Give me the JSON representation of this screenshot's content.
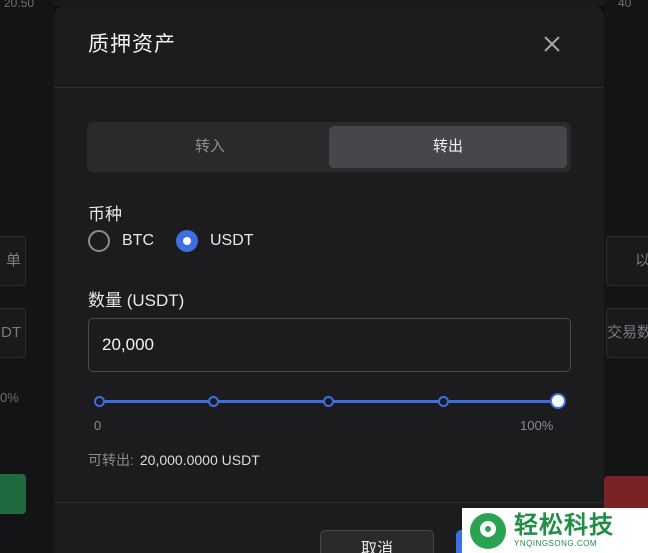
{
  "background": {
    "top_left_text": "20.50",
    "top_right_text": "40",
    "left_boxes": [
      "单",
      "DT"
    ],
    "left_percent": "0%",
    "right_boxes": [
      "以",
      "交易数"
    ]
  },
  "modal": {
    "title": "质押资产",
    "tabs": [
      {
        "label": "转入",
        "active": false
      },
      {
        "label": "转出",
        "active": true
      }
    ],
    "currency": {
      "label": "币种",
      "options": [
        {
          "label": "BTC",
          "checked": false
        },
        {
          "label": "USDT",
          "checked": true
        }
      ]
    },
    "amount": {
      "label": "数量 (USDT)",
      "value": "20,000"
    },
    "slider": {
      "min_label": "0",
      "max_label": "100%",
      "level": 1.0
    },
    "available": {
      "label": "可转出:",
      "value": "20,000.0000 USDT"
    },
    "buttons": {
      "cancel": "取消"
    }
  },
  "watermark": {
    "cn": "轻松科技",
    "en": "YNQINGSONG.COM"
  },
  "colors": {
    "accent": "#3d6fe0",
    "modal_bg": "#1c1c1e",
    "buy_green": "#1f6a3f",
    "sell_red": "#7a2326"
  }
}
